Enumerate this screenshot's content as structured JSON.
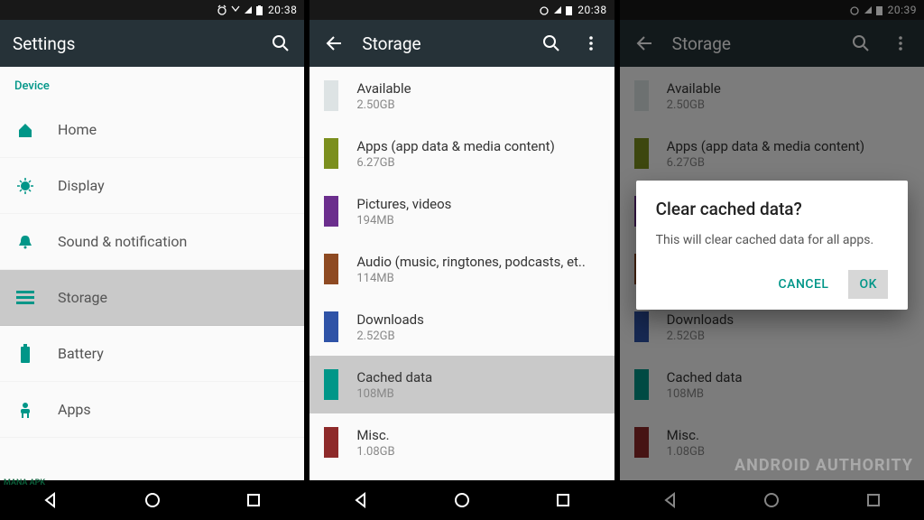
{
  "status": {
    "time_a": "20:38",
    "time_b": "20:38",
    "time_c": "20:39"
  },
  "settings": {
    "title": "Settings",
    "section": "Device",
    "items": [
      {
        "icon": "home",
        "label": "Home"
      },
      {
        "icon": "display",
        "label": "Display"
      },
      {
        "icon": "bell",
        "label": "Sound & notification"
      },
      {
        "icon": "storage",
        "label": "Storage",
        "selected": true
      },
      {
        "icon": "battery",
        "label": "Battery"
      },
      {
        "icon": "apps",
        "label": "Apps"
      }
    ]
  },
  "storage": {
    "title": "Storage",
    "rows": [
      {
        "color": "#DDE3E4",
        "label": "Available",
        "sub": "2.50GB"
      },
      {
        "color": "#7B8F1E",
        "label": "Apps (app data & media content)",
        "sub": "6.27GB"
      },
      {
        "color": "#6B2E8D",
        "label": "Pictures, videos",
        "sub": "194MB"
      },
      {
        "color": "#8E4A22",
        "label": "Audio (music, ringtones, podcasts, et..",
        "sub": "114MB"
      },
      {
        "color": "#2F53A7",
        "label": "Downloads",
        "sub": "2.52GB"
      },
      {
        "color": "#009688",
        "label": "Cached data",
        "sub": "108MB",
        "selected": true
      },
      {
        "color": "#8E2A2A",
        "label": "Misc.",
        "sub": "1.08GB"
      }
    ]
  },
  "dialog": {
    "title": "Clear cached data?",
    "body": "This will clear cached data for all apps.",
    "cancel": "CANCEL",
    "ok": "OK"
  },
  "brand": "ANDROID AUTHORITY",
  "watermark": "MANA APK"
}
